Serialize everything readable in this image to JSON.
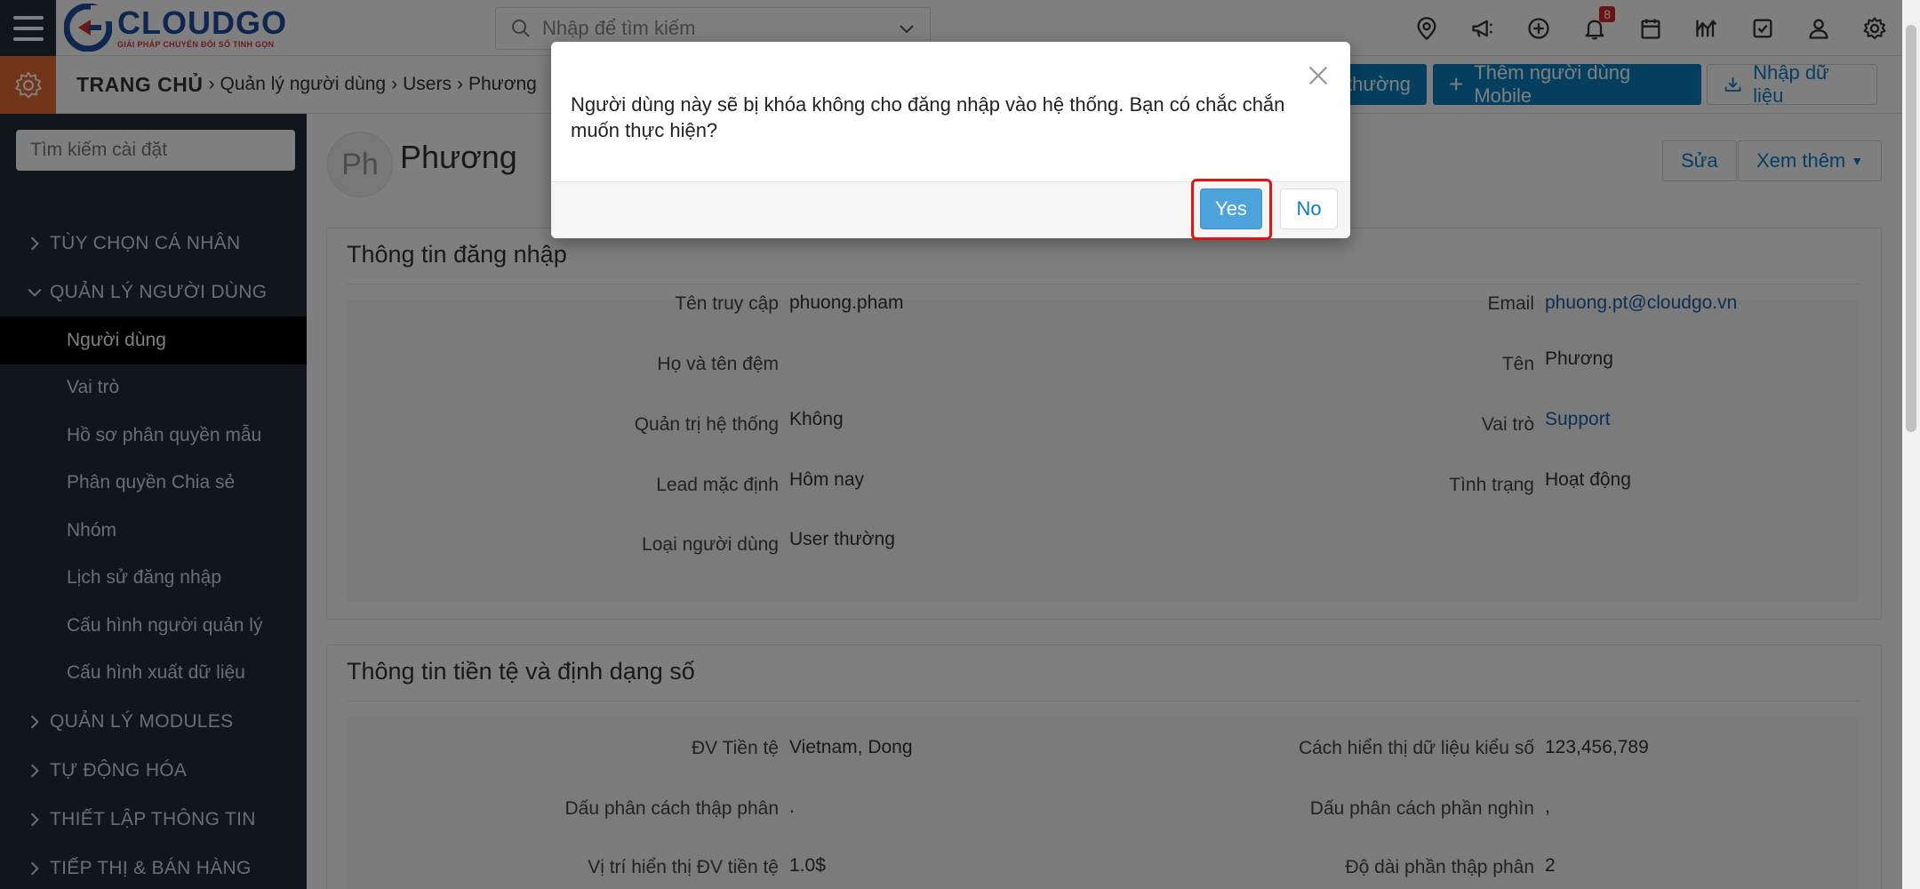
{
  "app": {
    "logo_name": "CLOUDGO",
    "logo_tagline": "GIẢI PHÁP CHUYỂN ĐỔI SỐ TINH GỌN",
    "search_placeholder": "Nhập để tìm kiếm",
    "notification_count": "8",
    "brand_color": "#1f4fa0",
    "accent_color": "#e8692f",
    "primary_button_color": "#0b7ec1"
  },
  "top_icons": [
    "map-pin-icon",
    "megaphone-icon",
    "plus-circle-icon",
    "bell-icon",
    "calendar-icon",
    "chart-icon",
    "checkbox-icon",
    "user-icon",
    "gear-icon"
  ],
  "breadcrumb": {
    "home": "TRANG CHỦ",
    "items": [
      "Quản lý người dùng",
      "Users",
      "Phương"
    ]
  },
  "header_buttons": {
    "add_regular": "thường",
    "add_mobile": "Thêm người dùng Mobile",
    "import": "Nhập dữ liệu"
  },
  "sidebar": {
    "search_placeholder": "Tìm kiếm cài đặt",
    "groups": {
      "personal": "TÙY CHỌN CÁ NHÂN",
      "user_mgmt": "QUẢN LÝ NGƯỜI DÙNG",
      "modules": "QUẢN LÝ MODULES",
      "automation": "TỰ ĐỘNG HÓA",
      "info_setup": "THIẾT LẬP THÔNG TIN",
      "marketing": "TIẾP THỊ & BÁN HÀNG"
    },
    "items": [
      "Người dùng",
      "Vai trò",
      "Hồ sơ phân quyền mẫu",
      "Phân quyền Chia sẻ",
      "Nhóm",
      "Lịch sử đăng nhập",
      "Cấu hình người quản lý",
      "Cấu hình xuất dữ liệu"
    ]
  },
  "profile": {
    "avatar_initials": "Ph",
    "name": "Phương",
    "edit_label": "Sửa",
    "more_label": "Xem thêm"
  },
  "login_info": {
    "title": "Thông tin đăng nhập",
    "left": [
      {
        "label": "Tên truy cập",
        "value": "phuong.pham"
      },
      {
        "label": "Họ và tên đệm",
        "value": ""
      },
      {
        "label": "Quản trị hệ thống",
        "value": "Không"
      },
      {
        "label": "Lead mặc định",
        "value": "Hôm nay"
      },
      {
        "label": "Loại người dùng",
        "value": "User thường"
      }
    ],
    "right": [
      {
        "label": "Email",
        "value": "phuong.pt@cloudgo.vn"
      },
      {
        "label": "Tên",
        "value": "Phương"
      },
      {
        "label": "Vai trò",
        "value": "Support"
      },
      {
        "label": "Tình trạng",
        "value": "Hoạt động"
      }
    ]
  },
  "currency_info": {
    "title": "Thông tin tiền tệ và định dạng số",
    "left": [
      {
        "label": "ĐV Tiền tệ",
        "value": "Vietnam, Dong"
      },
      {
        "label": "Dấu phân cách thập phân",
        "value": "."
      },
      {
        "label": "Vị trí hiển thị ĐV tiền tệ",
        "value": "1.0$"
      }
    ],
    "right": [
      {
        "label": "Cách hiển thị dữ liệu kiểu số",
        "value": "123,456,789"
      },
      {
        "label": "Dấu phân cách phần nghìn",
        "value": ","
      },
      {
        "label": "Độ dài phần thập phân",
        "value": "2"
      }
    ]
  },
  "modal": {
    "message": "Người dùng này sẽ bị khóa không cho đăng nhập vào hệ thống. Bạn có chắc chắn muốn thực hiện?",
    "yes_label": "Yes",
    "no_label": "No",
    "highlight_color": "#e01414"
  }
}
